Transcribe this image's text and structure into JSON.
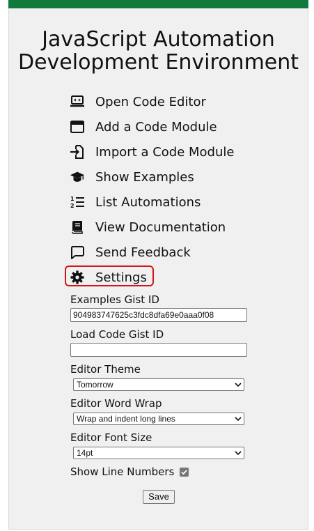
{
  "header": {
    "title_line1": "JavaScript Automation",
    "title_line2": "Development Environment"
  },
  "menu": {
    "items": [
      {
        "label": "Open Code Editor",
        "icon": "code-editor-icon"
      },
      {
        "label": "Add a Code Module",
        "icon": "window-icon"
      },
      {
        "label": "Import a Code Module",
        "icon": "import-icon"
      },
      {
        "label": "Show Examples",
        "icon": "graduation-cap-icon"
      },
      {
        "label": "List Automations",
        "icon": "numbered-list-icon"
      },
      {
        "label": "View Documentation",
        "icon": "book-icon"
      },
      {
        "label": "Send Feedback",
        "icon": "feedback-icon"
      },
      {
        "label": "Settings",
        "icon": "gear-icon"
      }
    ]
  },
  "settings": {
    "examples_gist_label": "Examples Gist ID",
    "examples_gist_value": "904983747625c3fdc8dfa69e0aaa0f08",
    "load_gist_label": "Load Code Gist ID",
    "load_gist_value": "",
    "theme_label": "Editor Theme",
    "theme_value": "Tomorrow",
    "wrap_label": "Editor Word Wrap",
    "wrap_value": "Wrap and indent long lines",
    "font_size_label": "Editor Font Size",
    "font_size_value": "14pt",
    "line_numbers_label": "Show Line Numbers",
    "line_numbers_checked": true,
    "save_label": "Save"
  },
  "colors": {
    "topbar": "#107a3c",
    "highlight": "#d4141b"
  }
}
